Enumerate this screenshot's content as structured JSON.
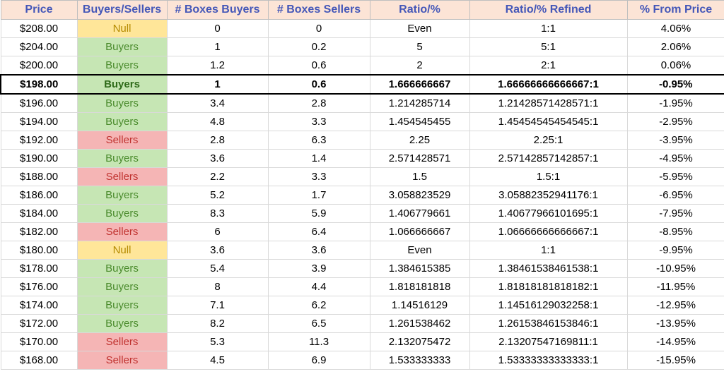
{
  "chart_data": {
    "type": "table",
    "title": "",
    "headers": [
      "Price",
      "Buyers/Sellers",
      "# Boxes Buyers",
      "# Boxes Sellers",
      "Ratio/%",
      "Ratio/% Refined",
      "% From Price"
    ],
    "rows": [
      {
        "price": "$208.00",
        "bs": "Null",
        "bb": "0",
        "sb": "0",
        "ratio": "Even",
        "refined": "1:1",
        "pct": "4.06%",
        "highlight": false
      },
      {
        "price": "$204.00",
        "bs": "Buyers",
        "bb": "1",
        "sb": "0.2",
        "ratio": "5",
        "refined": "5:1",
        "pct": "2.06%",
        "highlight": false
      },
      {
        "price": "$200.00",
        "bs": "Buyers",
        "bb": "1.2",
        "sb": "0.6",
        "ratio": "2",
        "refined": "2:1",
        "pct": "0.06%",
        "highlight": false
      },
      {
        "price": "$198.00",
        "bs": "Buyers",
        "bb": "1",
        "sb": "0.6",
        "ratio": "1.666666667",
        "refined": "1.66666666666667:1",
        "pct": "-0.95%",
        "highlight": true
      },
      {
        "price": "$196.00",
        "bs": "Buyers",
        "bb": "3.4",
        "sb": "2.8",
        "ratio": "1.214285714",
        "refined": "1.21428571428571:1",
        "pct": "-1.95%",
        "highlight": false
      },
      {
        "price": "$194.00",
        "bs": "Buyers",
        "bb": "4.8",
        "sb": "3.3",
        "ratio": "1.454545455",
        "refined": "1.45454545454545:1",
        "pct": "-2.95%",
        "highlight": false
      },
      {
        "price": "$192.00",
        "bs": "Sellers",
        "bb": "2.8",
        "sb": "6.3",
        "ratio": "2.25",
        "refined": "2.25:1",
        "pct": "-3.95%",
        "highlight": false
      },
      {
        "price": "$190.00",
        "bs": "Buyers",
        "bb": "3.6",
        "sb": "1.4",
        "ratio": "2.571428571",
        "refined": "2.57142857142857:1",
        "pct": "-4.95%",
        "highlight": false
      },
      {
        "price": "$188.00",
        "bs": "Sellers",
        "bb": "2.2",
        "sb": "3.3",
        "ratio": "1.5",
        "refined": "1.5:1",
        "pct": "-5.95%",
        "highlight": false
      },
      {
        "price": "$186.00",
        "bs": "Buyers",
        "bb": "5.2",
        "sb": "1.7",
        "ratio": "3.058823529",
        "refined": "3.05882352941176:1",
        "pct": "-6.95%",
        "highlight": false
      },
      {
        "price": "$184.00",
        "bs": "Buyers",
        "bb": "8.3",
        "sb": "5.9",
        "ratio": "1.406779661",
        "refined": "1.40677966101695:1",
        "pct": "-7.95%",
        "highlight": false
      },
      {
        "price": "$182.00",
        "bs": "Sellers",
        "bb": "6",
        "sb": "6.4",
        "ratio": "1.066666667",
        "refined": "1.06666666666667:1",
        "pct": "-8.95%",
        "highlight": false
      },
      {
        "price": "$180.00",
        "bs": "Null",
        "bb": "3.6",
        "sb": "3.6",
        "ratio": "Even",
        "refined": "1:1",
        "pct": "-9.95%",
        "highlight": false
      },
      {
        "price": "$178.00",
        "bs": "Buyers",
        "bb": "5.4",
        "sb": "3.9",
        "ratio": "1.384615385",
        "refined": "1.38461538461538:1",
        "pct": "-10.95%",
        "highlight": false
      },
      {
        "price": "$176.00",
        "bs": "Buyers",
        "bb": "8",
        "sb": "4.4",
        "ratio": "1.818181818",
        "refined": "1.81818181818182:1",
        "pct": "-11.95%",
        "highlight": false
      },
      {
        "price": "$174.00",
        "bs": "Buyers",
        "bb": "7.1",
        "sb": "6.2",
        "ratio": "1.14516129",
        "refined": "1.14516129032258:1",
        "pct": "-12.95%",
        "highlight": false
      },
      {
        "price": "$172.00",
        "bs": "Buyers",
        "bb": "8.2",
        "sb": "6.5",
        "ratio": "1.261538462",
        "refined": "1.26153846153846:1",
        "pct": "-13.95%",
        "highlight": false
      },
      {
        "price": "$170.00",
        "bs": "Sellers",
        "bb": "5.3",
        "sb": "11.3",
        "ratio": "2.132075472",
        "refined": "2.13207547169811:1",
        "pct": "-14.95%",
        "highlight": false
      },
      {
        "price": "$168.00",
        "bs": "Sellers",
        "bb": "4.5",
        "sb": "6.9",
        "ratio": "1.533333333",
        "refined": "1.53333333333333:1",
        "pct": "-15.95%",
        "highlight": false
      }
    ]
  }
}
